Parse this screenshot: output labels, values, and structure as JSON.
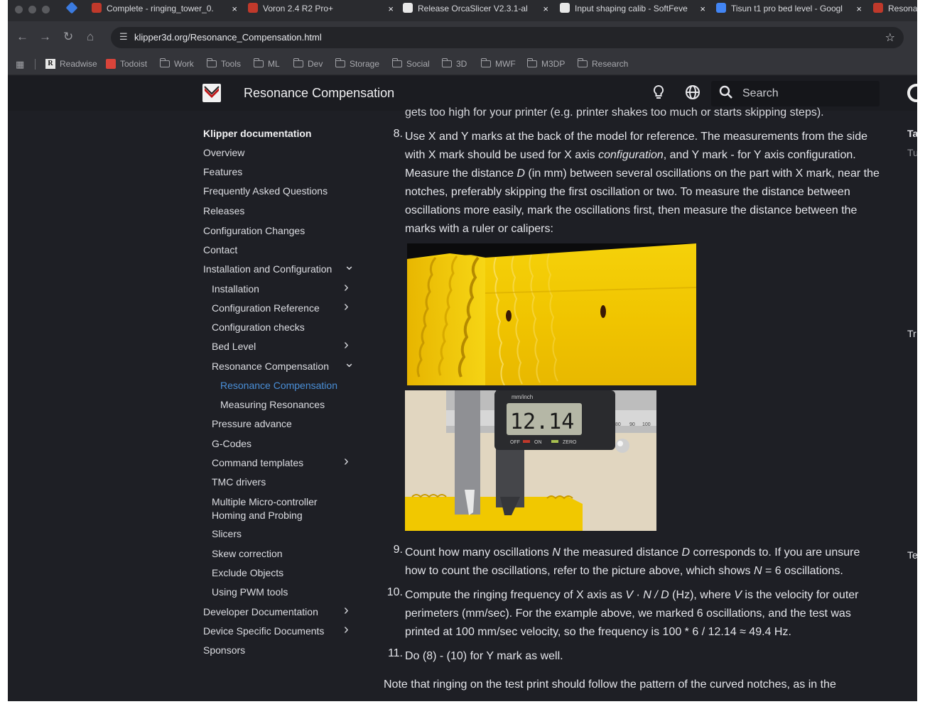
{
  "browser": {
    "tabs": [
      {
        "title": "Complete - ringing_tower_0.",
        "favicon_color": "#c0392b"
      },
      {
        "title": "Voron 2.4 R2 Pro+",
        "favicon_color": "#c0392b"
      },
      {
        "title": "Release OrcaSlicer V2.3.1-al",
        "favicon_color": "#e8e8e8"
      },
      {
        "title": "Input shaping calib - SoftFeve",
        "favicon_color": "#e8e8e8"
      },
      {
        "title": "Tisun t1 pro bed level - Googl",
        "favicon_color": "#4285f4"
      },
      {
        "title": "Resona",
        "favicon_color": "#c0392b"
      }
    ],
    "close_glyph": "×",
    "url": "klipper3d.org/Resonance_Compensation.html",
    "bookmarks": [
      {
        "label": "Readwise",
        "icon": "readwise-icon"
      },
      {
        "label": "Todoist",
        "icon": "todoist-icon"
      },
      {
        "label": "Work",
        "icon": "folder-icon"
      },
      {
        "label": "Tools",
        "icon": "folder-icon"
      },
      {
        "label": "ML",
        "icon": "folder-icon"
      },
      {
        "label": "Dev",
        "icon": "folder-icon"
      },
      {
        "label": "Storage",
        "icon": "folder-icon"
      },
      {
        "label": "Social",
        "icon": "folder-icon"
      },
      {
        "label": "3D",
        "icon": "folder-icon"
      },
      {
        "label": "MWF",
        "icon": "folder-icon"
      },
      {
        "label": "M3DP",
        "icon": "folder-icon"
      },
      {
        "label": "Research",
        "icon": "folder-icon"
      }
    ]
  },
  "header": {
    "title": "Resonance Compensation",
    "search_placeholder": "Search"
  },
  "sidebar": {
    "title": "Klipper documentation",
    "items": [
      {
        "label": "Overview",
        "level": 0
      },
      {
        "label": "Features",
        "level": 0
      },
      {
        "label": "Frequently Asked Questions",
        "level": 0
      },
      {
        "label": "Releases",
        "level": 0
      },
      {
        "label": "Configuration Changes",
        "level": 0
      },
      {
        "label": "Contact",
        "level": 0
      },
      {
        "label": "Installation and Configuration",
        "level": 0,
        "chevron": "down"
      },
      {
        "label": "Installation",
        "level": 1,
        "chevron": "right"
      },
      {
        "label": "Configuration Reference",
        "level": 1,
        "chevron": "right"
      },
      {
        "label": "Configuration checks",
        "level": 1
      },
      {
        "label": "Bed Level",
        "level": 1,
        "chevron": "right"
      },
      {
        "label": "Resonance Compensation",
        "level": 1,
        "chevron": "down"
      },
      {
        "label": "Resonance Compensation",
        "level": 2,
        "active": true
      },
      {
        "label": "Measuring Resonances",
        "level": 2
      },
      {
        "label": "Pressure advance",
        "level": 1
      },
      {
        "label": "G-Codes",
        "level": 1
      },
      {
        "label": "Command templates",
        "level": 1,
        "chevron": "right"
      },
      {
        "label": "TMC drivers",
        "level": 1
      },
      {
        "label": "Multiple Micro-controller Homing and Probing",
        "level": 1
      },
      {
        "label": "Slicers",
        "level": 1
      },
      {
        "label": "Skew correction",
        "level": 1
      },
      {
        "label": "Exclude Objects",
        "level": 1
      },
      {
        "label": "Using PWM tools",
        "level": 1
      },
      {
        "label": "Developer Documentation",
        "level": 0,
        "chevron": "right"
      },
      {
        "label": "Device Specific Documents",
        "level": 0,
        "chevron": "right"
      },
      {
        "label": "Sponsors",
        "level": 0
      }
    ]
  },
  "content": {
    "cut_line": "gets too high for your printer (e.g. printer shakes too much or starts skipping steps).",
    "step8": {
      "num": "8.",
      "a": "Use X and Y marks at the back of the model for reference. The measurements from the side with X mark should be used for X axis ",
      "a_em": "configuration",
      "b": ", and Y mark - for Y axis configuration. Measure the distance ",
      "b_em": "D",
      "c": " (in mm) between several oscillations on the part with X mark, near the notches, preferably skipping the first oscillation or two. To measure the distance between oscillations more easily, mark the oscillations first, then measure the distance between the marks with a ruler or calipers:"
    },
    "caliper": {
      "unit_label": "mm/inch",
      "reading": "12.14",
      "btn_off": "OFF",
      "btn_on": "ON",
      "btn_zero": "ZERO",
      "scale": [
        "80",
        "90",
        "100"
      ]
    },
    "step9": {
      "num": "9.",
      "a": "Count how many oscillations ",
      "a_em": "N",
      "b": " the measured distance ",
      "b_em": "D",
      "c": " corresponds to. If you are unsure how to count the oscillations, refer to the picture above, which shows ",
      "c_em": "N",
      "d": " = 6 oscillations."
    },
    "step10": {
      "num": "10.",
      "a": "Compute the ringing frequency of X axis as ",
      "a_em": "V · N / D",
      "b": " (Hz), where ",
      "b_em": "V",
      "c": " is the velocity for outer perimeters (mm/sec). For the example above, we marked 6 oscillations, and the test was printed at 100 mm/sec velocity, so the frequency is 100 * 6 / 12.14 ≈ 49.4 Hz."
    },
    "step11": {
      "num": "11.",
      "text": "Do (8) - (10) for Y mark as well."
    },
    "note": "Note that ringing on the test print should follow the pattern of the curved notches, as in the"
  },
  "toc": {
    "t1": "Ta",
    "t2": "Tu",
    "t3": "Tr",
    "t4": "Te"
  },
  "colors": {
    "page_bg": "#1e1f25",
    "header_bg": "#1b1c21",
    "accent_link": "#4a8fd8",
    "print_yellow": "#f0c400"
  }
}
